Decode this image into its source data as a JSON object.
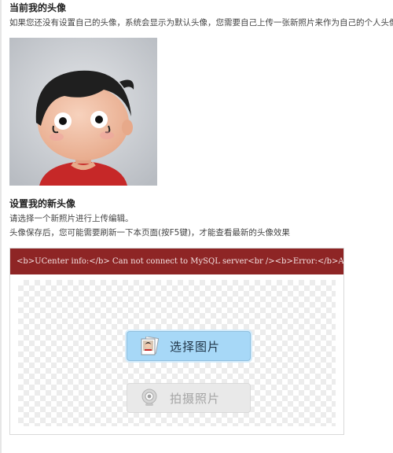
{
  "current_avatar": {
    "title": "当前我的头像",
    "description": "如果您还没有设置自己的头像，系统会显示为默认头像，您需要自己上传一张新照片来作为自己的个人头像"
  },
  "new_avatar": {
    "title": "设置我的新头像",
    "instruction": "请选择一个新照片进行上传编辑。",
    "note": "头像保存后，您可能需要刷新一下本页面(按F5键)，才能查看最新的头像效果"
  },
  "uploader": {
    "error_text": "<b>UCenter info:</b> Can not connect to MySQL server<br /><b>Error:</b>Access denied for user",
    "select_button_label": "选择图片",
    "camera_button_label": "拍摄照片",
    "error_bar_color": "#8e2525",
    "select_button_color": "#a7d8f7"
  },
  "icons": {
    "select_button": "photo-stack-icon",
    "camera_button": "webcam-icon"
  }
}
